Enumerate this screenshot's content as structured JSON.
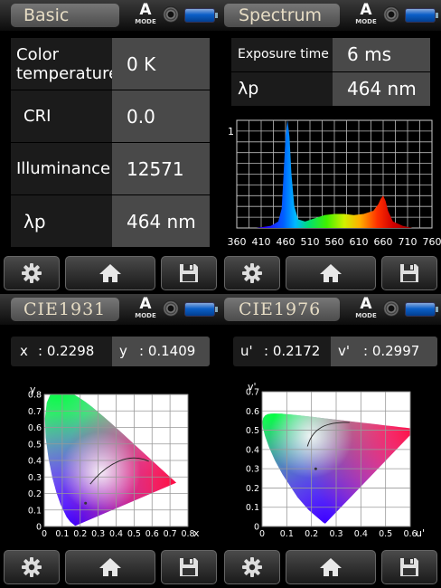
{
  "status": {
    "mode_letter": "A",
    "mode_label": "MODE"
  },
  "basic": {
    "tab": "Basic",
    "rows": [
      {
        "label": "Color temperature",
        "label_line1": "Color",
        "label_line2": "temperature",
        "value": "0 K"
      },
      {
        "label": "CRI",
        "value": "0.0"
      },
      {
        "label": "Illuminance",
        "value": "12571"
      },
      {
        "label": "λp",
        "value": "464 nm"
      }
    ]
  },
  "spectrum": {
    "tab": "Spectrum",
    "exposure_label": "Exposure time",
    "exposure_value": "6 ms",
    "peak_label": "λp",
    "peak_value": "464 nm"
  },
  "cie1931": {
    "tab": "CIE1931",
    "x_label": "x",
    "x_value": ": 0.2298",
    "y_label": "y",
    "y_value": ": 0.1409"
  },
  "cie1976": {
    "tab": "CIE1976",
    "u_label": "u'",
    "u_value": ": 0.2172",
    "v_label": "v'",
    "v_value": ": 0.2997"
  },
  "toolbar": {
    "settings_icon": "gear-icon",
    "home_icon": "home-icon",
    "save_icon": "floppy-disk-icon"
  },
  "chart_data": [
    {
      "type": "area",
      "ylabel_tick": "1",
      "x_ticks": [
        "360",
        "410",
        "460",
        "510",
        "560",
        "610",
        "660",
        "710",
        "760"
      ],
      "xlim": [
        360,
        760
      ],
      "ylim": [
        0,
        1
      ],
      "grid": true,
      "x": [
        360,
        400,
        430,
        445,
        452,
        456,
        460,
        464,
        468,
        472,
        478,
        486,
        500,
        520,
        540,
        560,
        580,
        600,
        620,
        640,
        650,
        655,
        660,
        665,
        670,
        680,
        700,
        720,
        760
      ],
      "y": [
        0,
        0,
        0.02,
        0.06,
        0.18,
        0.5,
        0.86,
        1.0,
        0.85,
        0.5,
        0.2,
        0.08,
        0.06,
        0.09,
        0.12,
        0.13,
        0.13,
        0.12,
        0.13,
        0.16,
        0.22,
        0.27,
        0.3,
        0.25,
        0.16,
        0.06,
        0.02,
        0,
        0
      ]
    },
    {
      "type": "scatter",
      "title": "",
      "xlabel": "x",
      "ylabel": "y",
      "x_ticks": [
        "0",
        "0.1",
        "0.2",
        "0.3",
        "0.4",
        "0.5",
        "0.6",
        "0.7",
        "0.8"
      ],
      "y_ticks": [
        "0",
        "0.1",
        "0.2",
        "0.3",
        "0.4",
        "0.5",
        "0.6",
        "0.7",
        "0.8"
      ],
      "xlim": [
        0,
        0.8
      ],
      "ylim": [
        0,
        0.8
      ],
      "grid": true,
      "point": {
        "x": 0.2298,
        "y": 0.1409
      }
    },
    {
      "type": "scatter",
      "title": "",
      "xlabel": "u'",
      "ylabel": "v'",
      "x_ticks": [
        "0",
        "0.1",
        "0.2",
        "0.3",
        "0.4",
        "0.5",
        "0.6"
      ],
      "y_ticks": [
        "0",
        "0.1",
        "0.2",
        "0.3",
        "0.4",
        "0.5",
        "0.6",
        "0.7"
      ],
      "xlim": [
        0,
        0.6
      ],
      "ylim": [
        0,
        0.7
      ],
      "grid": true,
      "point": {
        "x": 0.2172,
        "y": 0.2997
      }
    }
  ]
}
